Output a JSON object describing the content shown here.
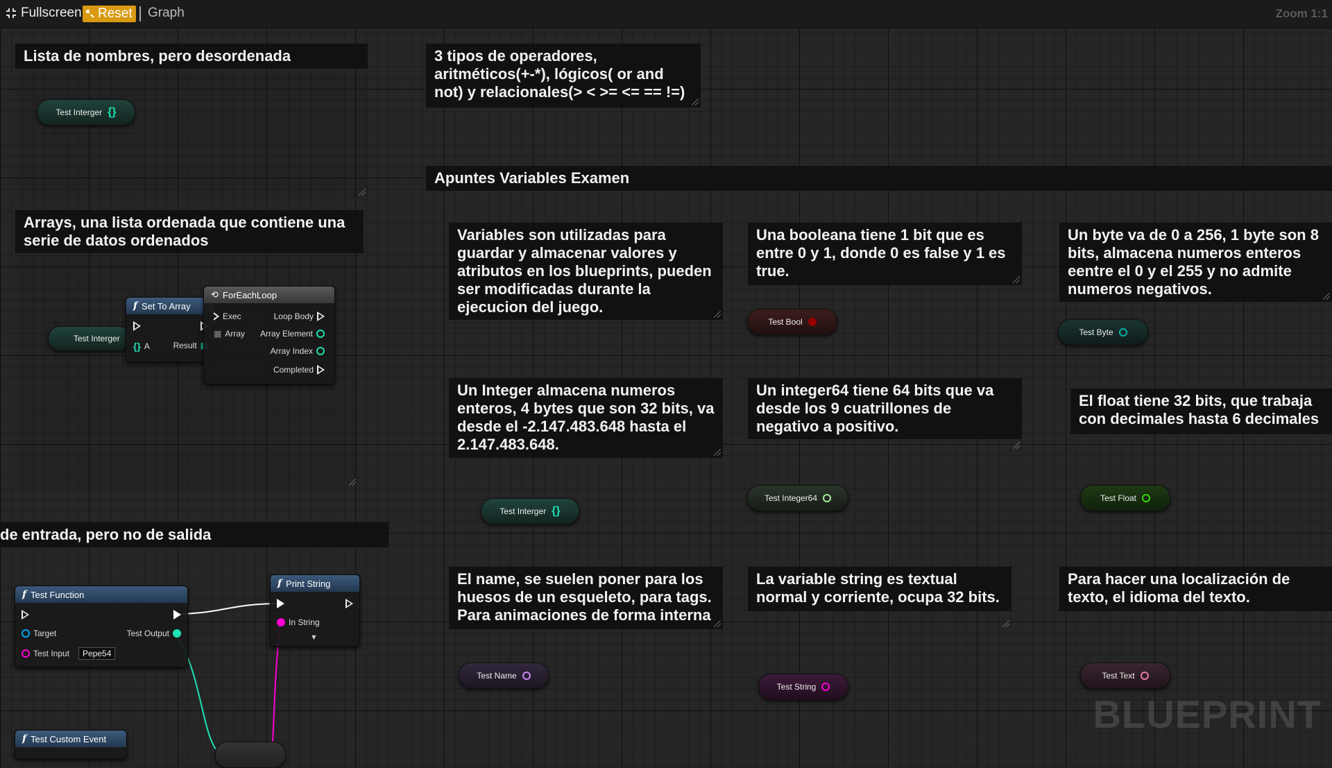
{
  "toolbar": {
    "fullscreen_label": "Fullscreen",
    "reset_label": "Reset",
    "graph_label": "Graph",
    "zoom_label": "Zoom 1:1"
  },
  "comments": {
    "c1": "Lista de nombres, pero desordenada",
    "c2": "3 tipos de operadores, aritméticos(+-*), lógicos( or and not) y relacionales(> < >= <= == !=)",
    "c3": "Apuntes Variables Examen",
    "c4": "Arrays, una lista ordenada que contiene una serie de datos ordenados",
    "c5": "Variables son utilizadas para guardar y almacenar valores y atributos en los blueprints, pueden ser modificadas durante la ejecucion del juego.",
    "c6": "Una booleana tiene 1 bit que es entre 0 y 1, donde 0 es false y 1 es true.",
    "c7": "Un byte va de 0 a 256, 1 byte son 8 bits, almacena numeros enteros eentre el 0 y el 255 y no admite numeros negativos.",
    "c8": "Un Integer almacena numeros enteros, 4 bytes que son 32 bits, va desde el -2.147.483.648 hasta el 2.147.483.648.",
    "c9": "Un integer64 tiene 64 bits que va desde los 9 cuatrillones de negativo a positivo.",
    "c10": "El float tiene 32 bits, que trabaja con decimales hasta 6 decimales",
    "c11": "de entrada, pero no de salida",
    "c12": "El name, se suelen poner para los huesos de un esqueleto, para tags. Para animaciones de forma interna",
    "c13": "La variable string es textual normal y corriente, ocupa 32 bits.",
    "c14": "Para hacer una localización de texto, el idioma del texto."
  },
  "variables": {
    "test_interger": "Test Interger",
    "test_bool": "Test Bool",
    "test_byte": "Test Byte",
    "test_integer64": "Test Integer64",
    "test_float": "Test Float",
    "test_name": "Test Name",
    "test_string": "Test String",
    "test_text": "Test Text"
  },
  "nodes": {
    "set_to_array": {
      "title": "Set To Array",
      "pin_a": "A",
      "result": "Result"
    },
    "foreach": {
      "title": "ForEachLoop",
      "exec": "Exec",
      "array": "Array",
      "loop_body": "Loop Body",
      "array_element": "Array Element",
      "array_index": "Array Index",
      "completed": "Completed"
    },
    "test_function": {
      "title": "Test Function",
      "target": "Target",
      "test_output": "Test Output",
      "test_input": "Test Input",
      "test_input_value": "Pepe54"
    },
    "print_string": {
      "title": "Print String",
      "in_string": "In String"
    },
    "custom_event": {
      "title": "Test Custom Event"
    }
  },
  "watermark": "BLUEPRINT",
  "colors": {
    "integer": "#1ee3b5",
    "bool": "#950000",
    "byte": "#006f65",
    "integer64": "#aaeea0",
    "float": "#38d500",
    "name": "#c88cff",
    "string": "#ff00d4",
    "text": "#e87ca8",
    "exec": "#ffffff",
    "object": "#00a8f4",
    "accent_reset": "#d89a10"
  }
}
